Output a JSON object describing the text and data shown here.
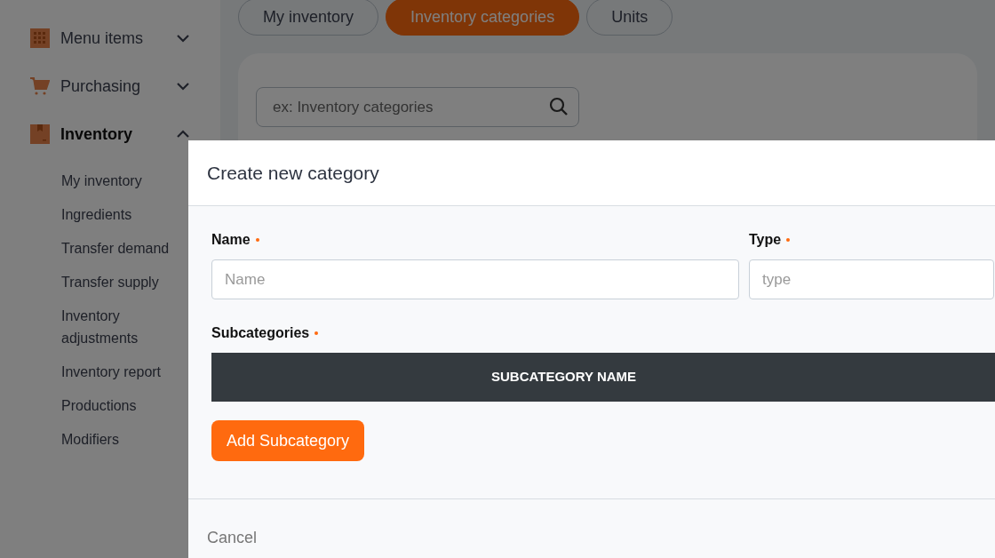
{
  "sidebar": {
    "items": [
      {
        "label": "Menu items",
        "expanded": false,
        "selected": false
      },
      {
        "label": "Purchasing",
        "expanded": false,
        "selected": false
      },
      {
        "label": "Inventory",
        "expanded": true,
        "selected": true,
        "children": [
          {
            "label": "My inventory"
          },
          {
            "label": "Ingredients"
          },
          {
            "label": "Transfer demand"
          },
          {
            "label": "Transfer supply"
          },
          {
            "label": "Inventory adjustments"
          },
          {
            "label": "Inventory report"
          },
          {
            "label": "Productions"
          },
          {
            "label": "Modifiers"
          }
        ]
      }
    ]
  },
  "tabs": [
    {
      "label": "My inventory",
      "selected": false
    },
    {
      "label": "Inventory categories",
      "selected": true
    },
    {
      "label": "Units",
      "selected": false
    }
  ],
  "search": {
    "placeholder": "ex: Inventory categories"
  },
  "modal": {
    "title": "Create new category",
    "fields": [
      {
        "label": "Name",
        "required": true,
        "placeholder": "Name"
      },
      {
        "label": "Type",
        "required": true,
        "placeholder": "type"
      }
    ],
    "subcategories": {
      "label": "Subcategories",
      "required": true,
      "columns": [
        "SUBCATEGORY NAME"
      ],
      "add_button": "Add Subcategory"
    },
    "cancel": "Cancel"
  }
}
